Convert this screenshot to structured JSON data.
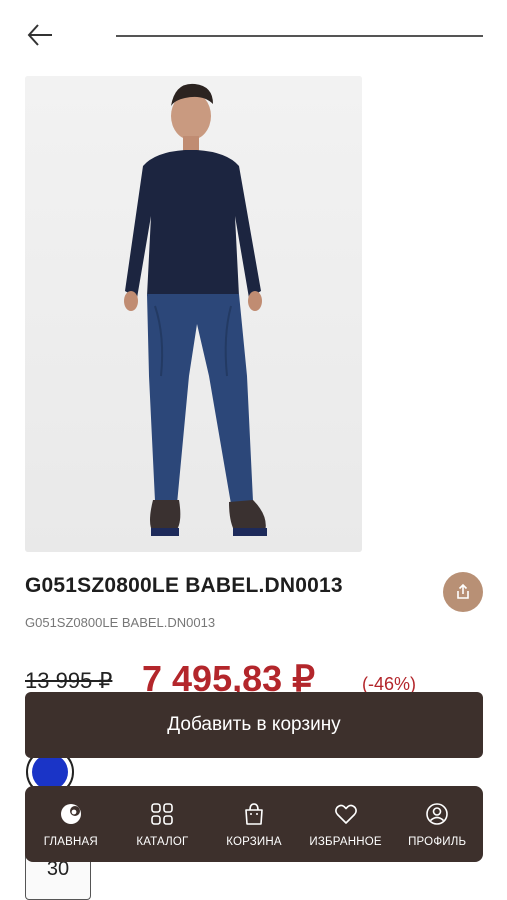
{
  "header": {
    "back_icon": "arrow-left-icon"
  },
  "product": {
    "title": "G051SZ0800LE BABEL.DN0013",
    "sku": "G051SZ0800LE BABEL.DN0013",
    "old_price": "13 995 ₽",
    "new_price": "7 495,83 ₽",
    "discount": "(-46%)",
    "image_alt": "Model in navy sweater and blue jeans",
    "color": "#1a34c7",
    "size": "30"
  },
  "actions": {
    "add_to_cart": "Добавить в корзину",
    "share_icon": "share-icon"
  },
  "colors": {
    "accent_dark": "#3d302c",
    "share_bg": "#b89075",
    "price_red": "#b3262b"
  },
  "nav": {
    "items": [
      {
        "label": "ГЛАВНАЯ",
        "icon": "home-logo-icon"
      },
      {
        "label": "КАТАЛОГ",
        "icon": "grid-icon"
      },
      {
        "label": "КОРЗИНА",
        "icon": "bag-icon"
      },
      {
        "label": "ИЗБРАННОЕ",
        "icon": "heart-icon"
      },
      {
        "label": "ПРОФИЛЬ",
        "icon": "profile-icon"
      }
    ]
  }
}
